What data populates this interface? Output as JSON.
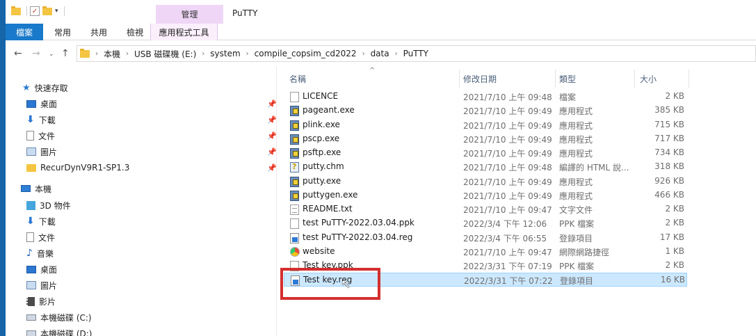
{
  "window": {
    "title": "PuTTY",
    "context_header": "管理"
  },
  "ribbon": {
    "tabs": [
      "檔案",
      "常用",
      "共用",
      "檢視",
      "應用程式工具"
    ]
  },
  "address": {
    "path": [
      "本機",
      "USB 磁碟機 (E:)",
      "system",
      "compile_copsim_cd2022",
      "data",
      "PuTTY"
    ]
  },
  "nav": {
    "items": [
      {
        "label": "快速存取",
        "icon": "star-icon"
      },
      {
        "label": "桌面",
        "icon": "desktop-icon",
        "pinned": true
      },
      {
        "label": "下載",
        "icon": "download-icon",
        "pinned": true
      },
      {
        "label": "文件",
        "icon": "document-icon",
        "pinned": true
      },
      {
        "label": "圖片",
        "icon": "pictures-icon",
        "pinned": true
      },
      {
        "label": "RecurDynV9R1-SP1.3",
        "icon": "folder-icon",
        "pinned": true
      },
      {
        "label": "本機",
        "icon": "computer-icon"
      },
      {
        "label": "3D 物件",
        "icon": "3d-objects-icon"
      },
      {
        "label": "下載",
        "icon": "download-icon"
      },
      {
        "label": "文件",
        "icon": "document-icon"
      },
      {
        "label": "音樂",
        "icon": "music-icon"
      },
      {
        "label": "桌面",
        "icon": "desktop-icon"
      },
      {
        "label": "圖片",
        "icon": "pictures-icon"
      },
      {
        "label": "影片",
        "icon": "video-icon"
      },
      {
        "label": "本機磁碟 (C:)",
        "icon": "drive-icon"
      },
      {
        "label": "本機磁碟 (D:)",
        "icon": "drive-icon"
      }
    ]
  },
  "columns": {
    "name": "名稱",
    "date": "修改日期",
    "type": "類型",
    "size": "大小"
  },
  "files": [
    {
      "name": "LICENCE",
      "date": "2021/7/10 上午 09:48",
      "type": "檔案",
      "size": "2 KB",
      "icon": "blank"
    },
    {
      "name": "pageant.exe",
      "date": "2021/7/10 上午 09:49",
      "type": "應用程式",
      "size": "385 KB",
      "icon": "exe"
    },
    {
      "name": "plink.exe",
      "date": "2021/7/10 上午 09:49",
      "type": "應用程式",
      "size": "715 KB",
      "icon": "exe"
    },
    {
      "name": "pscp.exe",
      "date": "2021/7/10 上午 09:49",
      "type": "應用程式",
      "size": "717 KB",
      "icon": "exe"
    },
    {
      "name": "psftp.exe",
      "date": "2021/7/10 上午 09:49",
      "type": "應用程式",
      "size": "734 KB",
      "icon": "exe"
    },
    {
      "name": "putty.chm",
      "date": "2021/7/10 上午 09:48",
      "type": "編譯的 HTML 說...",
      "size": "318 KB",
      "icon": "chm"
    },
    {
      "name": "putty.exe",
      "date": "2021/7/10 上午 09:49",
      "type": "應用程式",
      "size": "926 KB",
      "icon": "exe"
    },
    {
      "name": "puttygen.exe",
      "date": "2021/7/10 上午 09:49",
      "type": "應用程式",
      "size": "466 KB",
      "icon": "exe"
    },
    {
      "name": "README.txt",
      "date": "2021/7/10 上午 09:47",
      "type": "文字文件",
      "size": "2 KB",
      "icon": "txt"
    },
    {
      "name": "test PuTTY-2022.03.04.ppk",
      "date": "2022/3/4 下午 12:06",
      "type": "PPK 檔案",
      "size": "2 KB",
      "icon": "blank"
    },
    {
      "name": "test PuTTY-2022.03.04.reg",
      "date": "2022/3/4 下午 06:55",
      "type": "登錄項目",
      "size": "17 KB",
      "icon": "reg"
    },
    {
      "name": "website",
      "date": "2021/7/10 上午 09:47",
      "type": "網際網路捷徑",
      "size": "1 KB",
      "icon": "web"
    },
    {
      "name": "Test key.ppk",
      "date": "2022/3/31 下午 07:19",
      "type": "PPK 檔案",
      "size": "2 KB",
      "icon": "blank"
    },
    {
      "name": "Test key.reg",
      "date": "2022/3/31 下午 07:22",
      "type": "登錄項目",
      "size": "16 KB",
      "icon": "reg",
      "selected": true
    }
  ],
  "annotation_color": "#d32f2f",
  "selection_color": "#cce8ff"
}
